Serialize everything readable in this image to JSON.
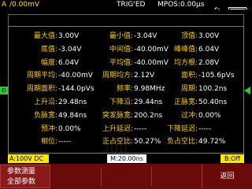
{
  "topbar": {
    "channel": "A",
    "trig_voltage": "/0.00mV",
    "trig_status": "TRIG'ED",
    "mpos": "MPOS:0.00μs",
    "usb_icon": "usb-icon",
    "battery_icon": "battery-icon"
  },
  "measurements": [
    {
      "label": "最大值:",
      "value": "3.00V",
      "label2": "最小值:",
      "value2": "-3.04V",
      "label3": "顶值:",
      "value3": "3.00V"
    },
    {
      "label": "底值:",
      "value": "-3.04V",
      "label2": "中间值:",
      "value2": "-40.00mV",
      "label3": "峰峰值:",
      "value3": "6.04V"
    },
    {
      "label": "幅度:",
      "value": "6.04V",
      "label2": "平均值:",
      "value2": "-40.00mV",
      "label3": "均方根:",
      "value3": "2.08V"
    },
    {
      "label": "周期平均:",
      "value": "-40.00mV",
      "label2": "周期均方:",
      "value2": "2.12V",
      "label3": "面积:",
      "value3": "-105.6pVs"
    },
    {
      "label": "周期面积:",
      "value": "-144.0pVs",
      "label2": "频率:",
      "value2": "9.98MHz",
      "label3": "周期:",
      "value3": "100.2ns"
    },
    {
      "label": "上升沿:",
      "value": "29.48ns",
      "label2": "下降沿:",
      "value2": "29.44ns",
      "label3": "正脉宽:",
      "value3": "50.40ns"
    },
    {
      "label": "负脉宽:",
      "value": "49.84ns",
      "label2": "突发脉宽:",
      "value2": "200.2ns",
      "label3": "过冲:",
      "value3": "0.00%"
    },
    {
      "label": "预冲:",
      "value": "0.00%",
      "label2": "上升延迟:",
      "value2": "-----",
      "label3": "下降延迟:",
      "value3": "-----"
    },
    {
      "label": "相位:",
      "value": "-----",
      "label2": "正占空比:",
      "value2": "50.27%",
      "label3": "负占空比:",
      "value3": "49.72%"
    }
  ],
  "infobar": {
    "channel_scale": "A:100V DC",
    "timebase": "M:20.00ns",
    "offset": "B:Off"
  },
  "softkeys": {
    "left_line1": "参数测量",
    "left_line2": "全部参数",
    "right": "返回"
  },
  "colors": {
    "label": "#ffd000",
    "value": "#ffffff",
    "softkey_bg": "#6a0a0a",
    "channel_yellow": "#ffe800"
  }
}
